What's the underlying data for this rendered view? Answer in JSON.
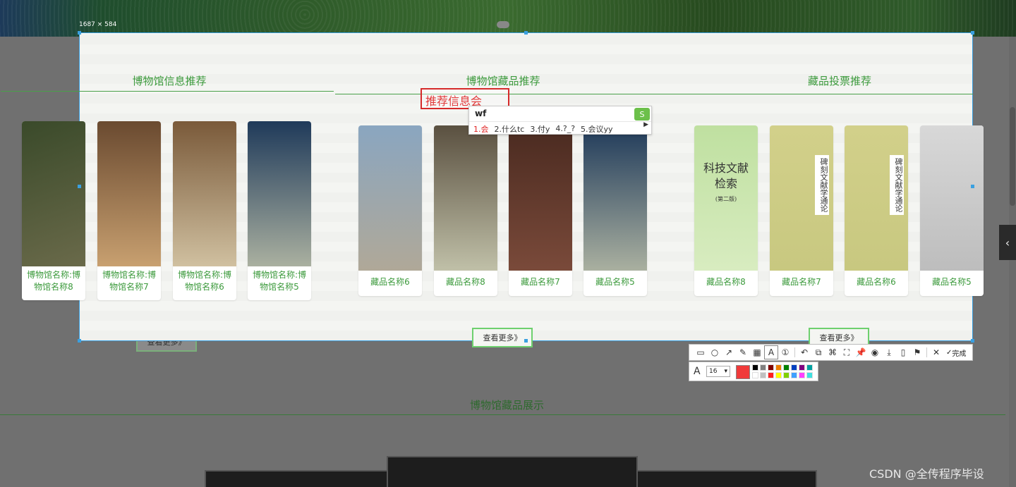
{
  "capture": {
    "size_label": "1687 × 584"
  },
  "sections": [
    {
      "title": "博物馆信息推荐",
      "cards": [
        {
          "caption": "博物馆名称:博物馆名称8",
          "colors": [
            "#3a4a2a",
            "#6a6a4a"
          ]
        },
        {
          "caption": "博物馆名称:博物馆名称7",
          "colors": [
            "#6a4a30",
            "#c8a070"
          ]
        },
        {
          "caption": "博物馆名称:博物馆名称6",
          "colors": [
            "#7a5a3a",
            "#d0c0a0"
          ]
        },
        {
          "caption": "博物馆名称:博物馆名称5",
          "colors": [
            "#1f3a5a",
            "#aab0a0"
          ]
        }
      ],
      "more_label": "查看更多》"
    },
    {
      "title": "博物馆藏品推荐",
      "cards": [
        {
          "caption": "藏品名称6",
          "colors": [
            "#8aa6c0",
            "#b0a898"
          ]
        },
        {
          "caption": "藏品名称8",
          "colors": [
            "#5a5040",
            "#c0c0a8"
          ]
        },
        {
          "caption": "藏品名称7",
          "colors": [
            "#4a2a20",
            "#7a4a3a"
          ]
        },
        {
          "caption": "藏品名称5",
          "colors": [
            "#1f3a5a",
            "#aab0a0"
          ]
        }
      ],
      "more_label": "查看更多》"
    },
    {
      "title": "藏品投票推荐",
      "cards": [
        {
          "caption": "藏品名称8",
          "colors": [
            "#bfe0a0",
            "#d8ecc0"
          ]
        },
        {
          "caption": "藏品名称7",
          "colors": [
            "#d2d08a",
            "#c8c880"
          ]
        },
        {
          "caption": "藏品名称6",
          "colors": [
            "#d2d08a",
            "#c8c880"
          ]
        },
        {
          "caption": "藏品名称5",
          "colors": [
            "#d8d8d8",
            "#bdbdbd"
          ]
        }
      ],
      "more_label": "查看更多》"
    }
  ],
  "book_cover": {
    "title_line1": "科技文献",
    "title_line2": "检索",
    "edition": "(第二版)"
  },
  "book_spine": "碑刻文献学通论",
  "annotation": {
    "text": "推荐信息会"
  },
  "ime": {
    "input": "wf",
    "logo": "S",
    "candidates": [
      "1.会",
      "2.什么tc",
      "3.付y",
      "4.?_?",
      "5.会议yy"
    ],
    "next": "▶"
  },
  "toolbar": {
    "tools": [
      {
        "name": "rectangle-tool-icon",
        "glyph": "▭"
      },
      {
        "name": "ellipse-tool-icon",
        "glyph": "○"
      },
      {
        "name": "arrow-tool-icon",
        "glyph": "↗"
      },
      {
        "name": "pen-tool-icon",
        "glyph": "✎"
      },
      {
        "name": "mosaic-tool-icon",
        "glyph": "▦"
      },
      {
        "name": "text-tool-icon",
        "glyph": "A"
      },
      {
        "name": "number-tool-icon",
        "glyph": "①"
      }
    ],
    "actions": [
      {
        "name": "undo-icon",
        "glyph": "↶"
      },
      {
        "name": "ocr-icon",
        "glyph": "⧉"
      },
      {
        "name": "translate-icon",
        "glyph": "⌘"
      },
      {
        "name": "scan-icon",
        "glyph": "⛶"
      },
      {
        "name": "pin-icon",
        "glyph": "📌"
      },
      {
        "name": "record-icon",
        "glyph": "◉"
      },
      {
        "name": "download-icon",
        "glyph": "⤓"
      },
      {
        "name": "save-icon",
        "glyph": "▯"
      },
      {
        "name": "bookmark-icon",
        "glyph": "⚑"
      }
    ],
    "cancel_glyph": "✕",
    "done_glyph": "✓",
    "done_label": "完成",
    "font_size": "16",
    "current_color": "#f03a3a",
    "palette": [
      "#000000",
      "#808080",
      "#800000",
      "#f08000",
      "#008000",
      "#0040c0",
      "#800080",
      "#00a0a0",
      "#ffffff",
      "#c0c0c0",
      "#ff2020",
      "#ffff00",
      "#80d000",
      "#40a0ff",
      "#ff40ff",
      "#40e0e0"
    ]
  },
  "background_page": {
    "section_title": "博物馆藏品展示"
  },
  "watermark": "CSDN @全传程序毕设"
}
